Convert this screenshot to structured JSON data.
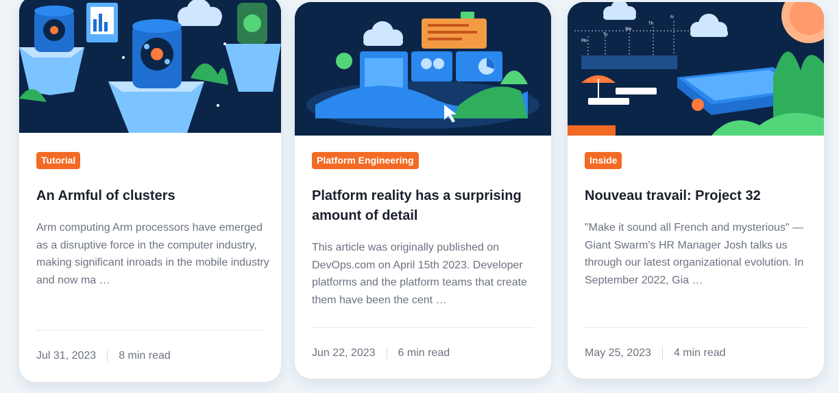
{
  "colors": {
    "tag_background": "#f26a24",
    "title_text": "#1a1f2b",
    "body_text": "#6b7280",
    "illustration_background": "#0b2548"
  },
  "articles": [
    {
      "tag": "Tutorial",
      "title": "An Armful of clusters",
      "excerpt": "Arm computing Arm processors have emerged as a disruptive force in the computer industry, making significant inroads in the mobile industry and now ma …",
      "date": "Jul 31, 2023",
      "read_time": "8 min read",
      "image_icon": "servers-clusters-illustration"
    },
    {
      "tag": "Platform Engineering",
      "title": "Platform reality has a surprising amount of detail",
      "excerpt": "This article was originally published on DevOps.com on April 15th 2023. Developer platforms and the platform teams that create them have been the cent …",
      "date": "Jun 22, 2023",
      "read_time": "6 min read",
      "image_icon": "platform-dashboard-illustration"
    },
    {
      "tag": "Inside",
      "title": "Nouveau travail: Project 32",
      "excerpt": "\"Make it sound all French and mysterious\" — Giant Swarm's HR Manager Josh talks us through our latest organizational evolution. In September 2022, Gia …",
      "date": "May 25, 2023",
      "read_time": "4 min read",
      "image_icon": "pool-calendar-illustration",
      "calendar_labels": [
        "Mo",
        "Tu",
        "We",
        "Th",
        "Fr"
      ]
    }
  ]
}
